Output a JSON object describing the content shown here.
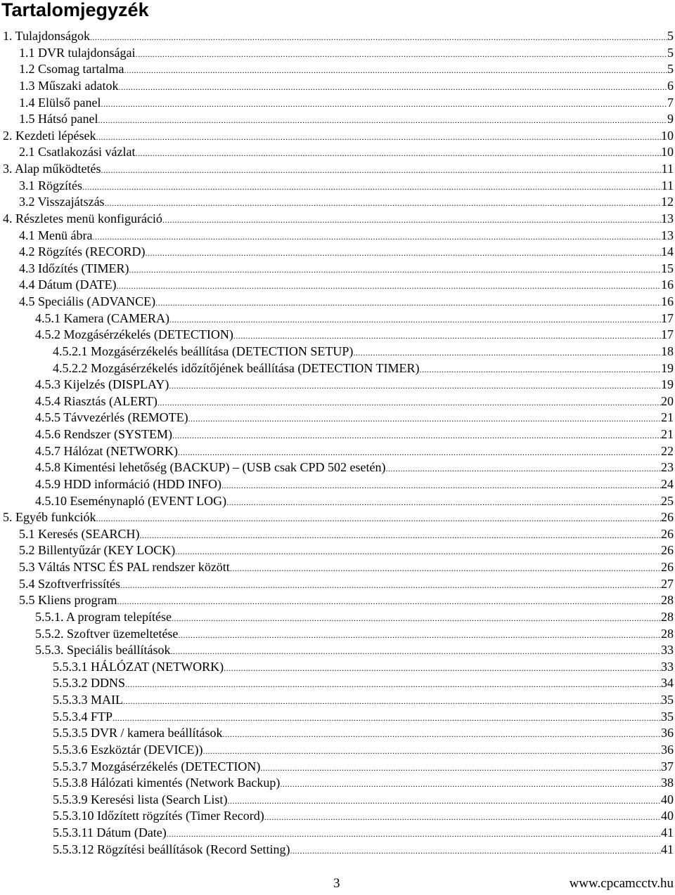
{
  "title": "Tartalomjegyzék",
  "entries": [
    {
      "label": "1. Tulajdonságok",
      "page": "5",
      "level": 0
    },
    {
      "label": "1.1 DVR tulajdonságai",
      "page": "5",
      "level": 1
    },
    {
      "label": "1.2 Csomag tartalma",
      "page": "5",
      "level": 1
    },
    {
      "label": "1.3 Műszaki adatok",
      "page": "6",
      "level": 1
    },
    {
      "label": "1.4 Elülső panel",
      "page": "7",
      "level": 1
    },
    {
      "label": "1.5 Hátsó panel",
      "page": "9",
      "level": 1
    },
    {
      "label": "2. Kezdeti lépések",
      "page": "10",
      "level": 0
    },
    {
      "label": "2.1 Csatlakozási vázlat",
      "page": "10",
      "level": 1
    },
    {
      "label": "3. Alap működtetés",
      "page": "11",
      "level": 0
    },
    {
      "label": "3.1 Rögzítés",
      "page": "11",
      "level": 1
    },
    {
      "label": "3.2 Visszajátszás",
      "page": "12",
      "level": 1
    },
    {
      "label": "4. Részletes menü konfiguráció",
      "page": "13",
      "level": 0
    },
    {
      "label": "4.1 Menü ábra",
      "page": "13",
      "level": 1
    },
    {
      "label": "4.2 Rögzítés (RECORD)",
      "page": "14",
      "level": 1
    },
    {
      "label": "4.3 Időzítés (TIMER)",
      "page": "15",
      "level": 1
    },
    {
      "label": "4.4 Dátum (DATE)",
      "page": "16",
      "level": 1
    },
    {
      "label": "4.5 Speciális (ADVANCE)",
      "page": "16",
      "level": 1
    },
    {
      "label": "4.5.1 Kamera (CAMERA)",
      "page": "17",
      "level": 2
    },
    {
      "label": "4.5.2 Mozgásérzékelés (DETECTION)",
      "page": "17",
      "level": 2
    },
    {
      "label": "4.5.2.1 Mozgásérzékelés beállítása (DETECTION SETUP)",
      "page": "18",
      "level": 3
    },
    {
      "label": "4.5.2.2 Mozgásérzékelés időzítőjének beállítása (DETECTION TIMER)",
      "page": "19",
      "level": 3
    },
    {
      "label": "4.5.3 Kijelzés (DISPLAY)",
      "page": "19",
      "level": 2
    },
    {
      "label": "4.5.4 Riasztás (ALERT)",
      "page": "20",
      "level": 2
    },
    {
      "label": "4.5.5 Távvezérlés (REMOTE)",
      "page": "21",
      "level": 2
    },
    {
      "label": "4.5.6 Rendszer (SYSTEM)",
      "page": "21",
      "level": 2
    },
    {
      "label": "4.5.7 Hálózat (NETWORK)",
      "page": "22",
      "level": 2
    },
    {
      "label": "4.5.8 Kimentési lehetőség (BACKUP) – (USB csak CPD 502 esetén)",
      "page": "23",
      "level": 2
    },
    {
      "label": "4.5.9 HDD információ (HDD INFO)",
      "page": "24",
      "level": 2
    },
    {
      "label": "4.5.10 Eseménynapló (EVENT LOG)",
      "page": "25",
      "level": 2
    },
    {
      "label": "5. Egyéb funkciók",
      "page": "26",
      "level": 0
    },
    {
      "label": "5.1 Keresés (SEARCH)",
      "page": "26",
      "level": 1
    },
    {
      "label": "5.2 Billentyűzár (KEY LOCK)",
      "page": "26",
      "level": 1
    },
    {
      "label": "5.3 Váltás NTSC ÉS PAL rendszer között",
      "page": "26",
      "level": 1
    },
    {
      "label": "5.4 Szoftverfrissítés",
      "page": "27",
      "level": 1
    },
    {
      "label": "5.5 Kliens program",
      "page": "28",
      "level": 1
    },
    {
      "label": "5.5.1. A program telepítése",
      "page": "28",
      "level": 2
    },
    {
      "label": "5.5.2. Szoftver üzemeltetése",
      "page": "28",
      "level": 2
    },
    {
      "label": "5.5.3. Speciális beállítások",
      "page": "33",
      "level": 2
    },
    {
      "label": "5.5.3.1 HÁLÓZAT (NETWORK)",
      "page": "33",
      "level": 3
    },
    {
      "label": "5.5.3.2 DDNS",
      "page": "34",
      "level": 3
    },
    {
      "label": "5.5.3.3 MAIL",
      "page": "35",
      "level": 3
    },
    {
      "label": "5.5.3.4 FTP",
      "page": "35",
      "level": 3
    },
    {
      "label": "5.5.3.5 DVR / kamera beállítások",
      "page": "36",
      "level": 3
    },
    {
      "label": "5.5.3.6 Eszköztár (DEVICE))",
      "page": "36",
      "level": 3
    },
    {
      "label": "5.5.3.7 Mozgásérzékelés (DETECTION)",
      "page": "37",
      "level": 3
    },
    {
      "label": "5.5.3.8 Hálózati kimentés (Network Backup)",
      "page": "38",
      "level": 3
    },
    {
      "label": "5.5.3.9 Keresési lista (Search List)",
      "page": "40",
      "level": 3
    },
    {
      "label": "5.5.3.10 Időzített rögzítés (Timer Record)",
      "page": "40",
      "level": 3
    },
    {
      "label": "5.5.3.11 Dátum (Date)",
      "page": "41",
      "level": 3
    },
    {
      "label": "5.5.3.12 Rögzítési beállítások (Record Setting)",
      "page": "41",
      "level": 3
    }
  ],
  "footer": {
    "page_number": "3",
    "website": "www.cpcamcctv.hu"
  }
}
